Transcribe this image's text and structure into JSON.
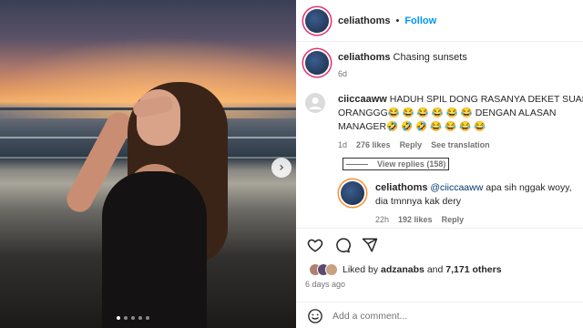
{
  "post": {
    "username": "celiathoms",
    "separator": "•",
    "follow_label": "Follow",
    "caption": "Chasing sunsets",
    "caption_age": "6d"
  },
  "comments": [
    {
      "username": "ciiccaaww",
      "text": "HADUH SPIL DONG RASANYA DEKET SUAMI ORANGGG😂 😂 😂 😂 😂 😂 DENGAN ALASAN MANAGER🤣 🤣 🤣 😂 😂 😂 😂",
      "age": "1d",
      "likes": "276 likes",
      "reply_label": "Reply",
      "translate_label": "See translation",
      "view_replies": "View replies (158)"
    }
  ],
  "reply": {
    "username": "celiathoms",
    "mention": "@ciiccaaww",
    "text": "apa sih nggak woyy, dia tmnnya kak dery",
    "age": "22h",
    "likes": "192 likes",
    "reply_label": "Reply"
  },
  "likes_line": {
    "prefix": "Liked by",
    "user": "adzanabs",
    "and": "and",
    "others": "7,171 others"
  },
  "posted_ago": "6 days ago",
  "comment_placeholder": "Add a comment...",
  "icons": [
    "heart-icon",
    "comment-icon",
    "share-icon",
    "smile-icon",
    "chevron-right-icon"
  ],
  "carousel": {
    "count": 5,
    "active_index": 0
  },
  "colors": {
    "follow": "#0095f6",
    "mention": "#00376b",
    "muted": "#737373"
  }
}
